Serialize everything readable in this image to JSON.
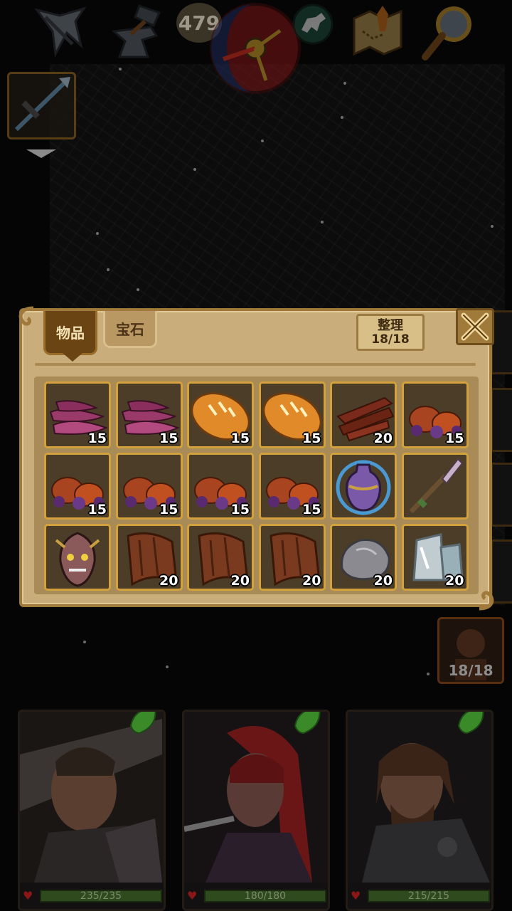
{
  "hud": {
    "gold": "479",
    "icons": [
      "crossbow-icon",
      "anvil-icon",
      "compass-icon",
      "dinosaur-icon",
      "treasure-map-icon",
      "magnifier-icon"
    ]
  },
  "inventory": {
    "tabs": [
      "物品",
      "宝石"
    ],
    "active_tab": "物品",
    "sort_label": "整理",
    "capacity": "18/18",
    "items": [
      {
        "icon": "jerky-icon",
        "qty": "15"
      },
      {
        "icon": "jerky-icon",
        "qty": "15"
      },
      {
        "icon": "bread-icon",
        "qty": "15"
      },
      {
        "icon": "bread-icon",
        "qty": "15"
      },
      {
        "icon": "bark-strips-icon",
        "qty": "20"
      },
      {
        "icon": "berries-icon",
        "qty": "15"
      },
      {
        "icon": "berries-icon",
        "qty": "15"
      },
      {
        "icon": "berries-icon",
        "qty": "15"
      },
      {
        "icon": "berries-icon",
        "qty": "15"
      },
      {
        "icon": "berries-icon",
        "qty": "15"
      },
      {
        "icon": "magic-vase-icon",
        "qty": ""
      },
      {
        "icon": "spear-icon",
        "qty": ""
      },
      {
        "icon": "demon-mask-icon",
        "qty": ""
      },
      {
        "icon": "leather-hide-icon",
        "qty": "20"
      },
      {
        "icon": "leather-hide-icon",
        "qty": "20"
      },
      {
        "icon": "leather-hide-icon",
        "qty": "20"
      },
      {
        "icon": "stone-icon",
        "qty": "20"
      },
      {
        "icon": "crystal-icon",
        "qty": "20"
      }
    ]
  },
  "troop_count": "18/18",
  "heroes": [
    {
      "name_icon": "warrior-portrait",
      "hp": "235/235"
    },
    {
      "name_icon": "rogue-portrait",
      "hp": "180/180"
    },
    {
      "name_icon": "knight-portrait",
      "hp": "215/215"
    }
  ],
  "colors": {
    "panel": "#c9ad7a",
    "slot_border": "#d4a23c",
    "hp_bar": "#2f4a1c"
  }
}
